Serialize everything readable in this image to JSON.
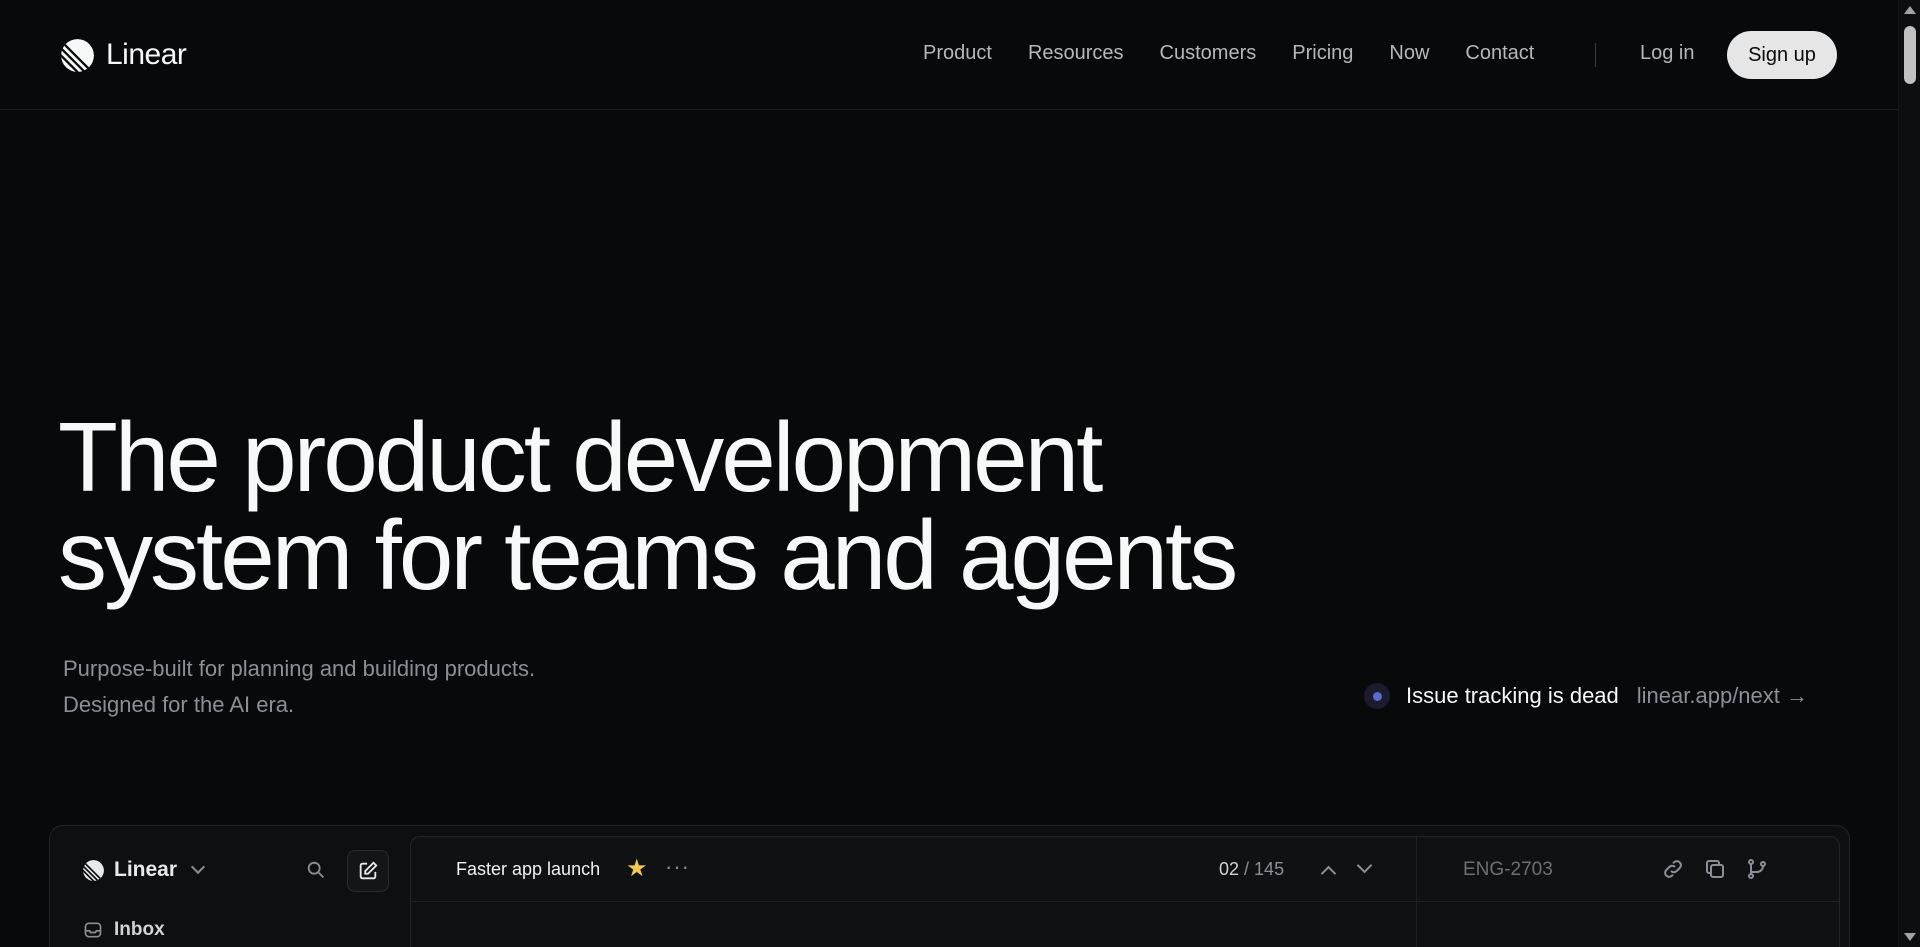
{
  "nav": {
    "brand": "Linear",
    "links": [
      "Product",
      "Resources",
      "Customers",
      "Pricing",
      "Now",
      "Contact"
    ],
    "login": "Log in",
    "signup": "Sign up"
  },
  "hero": {
    "title_line1": "The product development",
    "title_line2": "system for teams and agents",
    "sub_line1": "Purpose-built for planning and building products.",
    "sub_line2": "Designed for the AI era.",
    "announce_title": "Issue tracking is dead",
    "announce_link": "linear.app/next →"
  },
  "app": {
    "workspace": "Linear",
    "inbox": "Inbox",
    "issue_title": "Faster app launch",
    "counter_current": "02",
    "counter_sep": " / ",
    "counter_total": "145",
    "issue_id": "ENG-2703"
  },
  "colors": {
    "background": "#08090a",
    "accent": "#5e6ad2",
    "star": "#f2c94c"
  }
}
